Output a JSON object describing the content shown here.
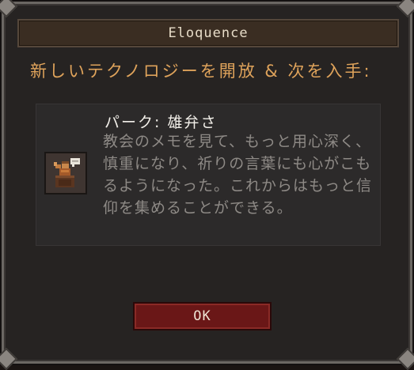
{
  "dialog": {
    "title": "Eloquence",
    "heading": "新しいテクノロジーを開放 & 次を入手:",
    "perk": {
      "icon": "orator-podium-icon",
      "title": "パーク: 雄弁さ",
      "description": "教会のメモを見て、もっと用心深く、慎重になり、祈りの言葉にも心がこもるようになった。これからはもっと信仰を集めることができる。"
    },
    "ok_label": "OK"
  },
  "colors": {
    "heading": "#dfa35b",
    "button": "#6a1717",
    "title_bar": "#3a2d22"
  }
}
